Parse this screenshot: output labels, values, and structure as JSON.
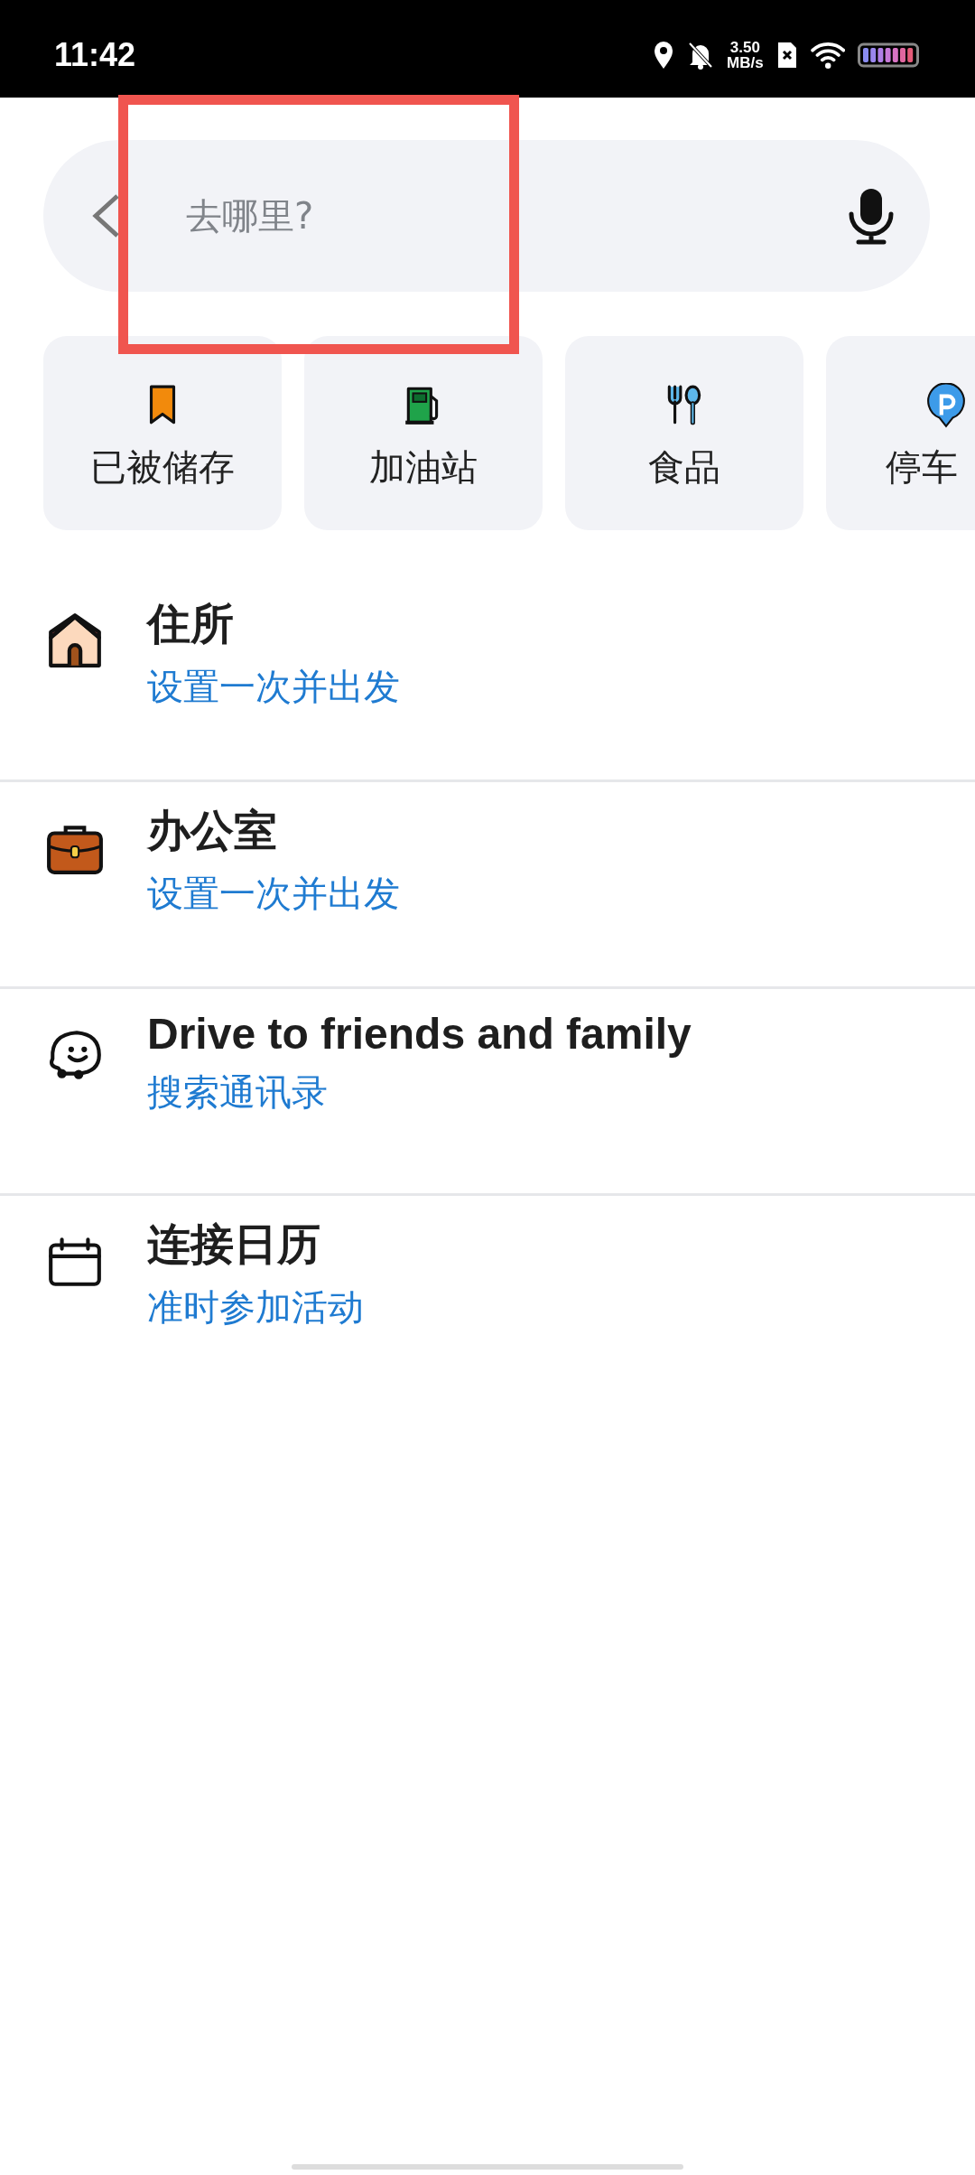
{
  "status_bar": {
    "time": "11:42",
    "speed_value": "3.50",
    "speed_unit": "MB/s"
  },
  "search": {
    "placeholder": "去哪里?"
  },
  "categories": [
    {
      "kind": "saved",
      "label": "已被储存"
    },
    {
      "kind": "gas",
      "label": "加油站"
    },
    {
      "kind": "food",
      "label": "食品"
    },
    {
      "kind": "parking",
      "label": "停车"
    }
  ],
  "shortcuts": [
    {
      "kind": "home",
      "title": "住所",
      "subtitle": "设置一次并出发"
    },
    {
      "kind": "work",
      "title": "办公室",
      "subtitle": "设置一次并出发"
    },
    {
      "kind": "friends",
      "title": "Drive to friends and family",
      "subtitle": "搜索通讯录"
    },
    {
      "kind": "calendar",
      "title": "连接日历",
      "subtitle": "准时参加活动"
    }
  ]
}
